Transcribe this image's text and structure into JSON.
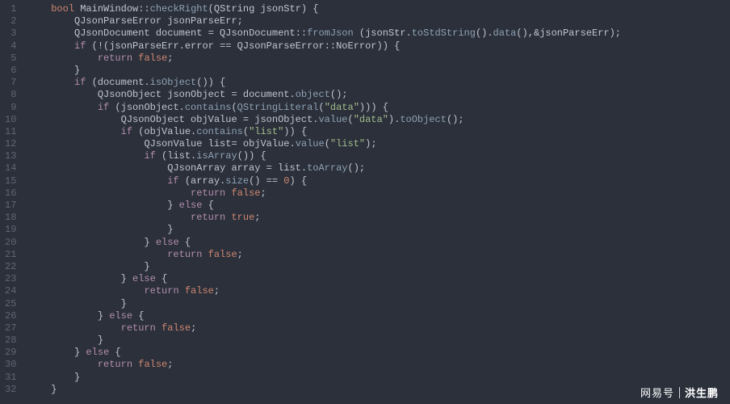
{
  "editor": {
    "language": "cpp",
    "line_count": 32,
    "colors": {
      "background": "#2b303b",
      "foreground": "#c0c5ce",
      "gutter": "#5f6773",
      "keyword": "#b48ead",
      "type": "#d08770",
      "class": "#ebcb8b",
      "function": "#8fa1b3",
      "string": "#a3be8c",
      "number": "#d08770",
      "boolean": "#d08770"
    },
    "lines": [
      {
        "n": 1,
        "indent": 1,
        "tokens": [
          [
            "type",
            "bool"
          ],
          [
            "ident",
            " MainWindow"
          ],
          [
            "op",
            "::"
          ],
          [
            "func",
            "checkRight"
          ],
          [
            "punct",
            "("
          ],
          [
            "ident",
            "QString jsonStr"
          ],
          [
            "punct",
            ") {"
          ]
        ]
      },
      {
        "n": 2,
        "indent": 2,
        "tokens": [
          [
            "ident",
            "QJsonParseError jsonParseErr;"
          ]
        ]
      },
      {
        "n": 3,
        "indent": 2,
        "tokens": [
          [
            "ident",
            "QJsonDocument document "
          ],
          [
            "op",
            "="
          ],
          [
            "ident",
            " QJsonDocument"
          ],
          [
            "op",
            "::"
          ],
          [
            "func",
            "fromJson"
          ],
          [
            "ident",
            " (jsonStr."
          ],
          [
            "func",
            "toStdString"
          ],
          [
            "punct",
            "()."
          ],
          [
            "func",
            "data"
          ],
          [
            "punct",
            "(),"
          ],
          [
            "op",
            "&"
          ],
          [
            "ident",
            "jsonParseErr);"
          ]
        ]
      },
      {
        "n": 4,
        "indent": 2,
        "tokens": [
          [
            "kw",
            "if"
          ],
          [
            "ident",
            " ("
          ],
          [
            "op",
            "!"
          ],
          [
            "ident",
            "(jsonParseErr.error "
          ],
          [
            "op",
            "=="
          ],
          [
            "ident",
            " QJsonParseError"
          ],
          [
            "op",
            "::"
          ],
          [
            "ident",
            "NoError)) {"
          ]
        ]
      },
      {
        "n": 5,
        "indent": 3,
        "tokens": [
          [
            "kw",
            "return"
          ],
          [
            "ident",
            " "
          ],
          [
            "bool",
            "false"
          ],
          [
            "punct",
            ";"
          ]
        ]
      },
      {
        "n": 6,
        "indent": 2,
        "tokens": [
          [
            "punct",
            "}"
          ]
        ]
      },
      {
        "n": 7,
        "indent": 2,
        "tokens": [
          [
            "kw",
            "if"
          ],
          [
            "ident",
            " (document."
          ],
          [
            "func",
            "isObject"
          ],
          [
            "punct",
            "()) {"
          ]
        ]
      },
      {
        "n": 8,
        "indent": 3,
        "tokens": [
          [
            "ident",
            "QJsonObject jsonObject "
          ],
          [
            "op",
            "="
          ],
          [
            "ident",
            " document."
          ],
          [
            "func",
            "object"
          ],
          [
            "punct",
            "();"
          ]
        ]
      },
      {
        "n": 9,
        "indent": 3,
        "tokens": [
          [
            "kw",
            "if"
          ],
          [
            "ident",
            " (jsonObject."
          ],
          [
            "func",
            "contains"
          ],
          [
            "punct",
            "("
          ],
          [
            "func",
            "QStringLiteral"
          ],
          [
            "punct",
            "("
          ],
          [
            "str",
            "\"data\""
          ],
          [
            "punct",
            "))) {"
          ]
        ]
      },
      {
        "n": 10,
        "indent": 4,
        "tokens": [
          [
            "ident",
            "QJsonObject objValue "
          ],
          [
            "op",
            "="
          ],
          [
            "ident",
            " jsonObject."
          ],
          [
            "func",
            "value"
          ],
          [
            "punct",
            "("
          ],
          [
            "str",
            "\"data\""
          ],
          [
            "punct",
            ")."
          ],
          [
            "func",
            "toObject"
          ],
          [
            "punct",
            "();"
          ]
        ]
      },
      {
        "n": 11,
        "indent": 4,
        "tokens": [
          [
            "kw",
            "if"
          ],
          [
            "ident",
            " (objValue."
          ],
          [
            "func",
            "contains"
          ],
          [
            "punct",
            "("
          ],
          [
            "str",
            "\"list\""
          ],
          [
            "punct",
            ")) {"
          ]
        ]
      },
      {
        "n": 12,
        "indent": 5,
        "tokens": [
          [
            "ident",
            "QJsonValue list"
          ],
          [
            "op",
            "="
          ],
          [
            "ident",
            " objValue."
          ],
          [
            "func",
            "value"
          ],
          [
            "punct",
            "("
          ],
          [
            "str",
            "\"list\""
          ],
          [
            "punct",
            ");"
          ]
        ]
      },
      {
        "n": 13,
        "indent": 5,
        "tokens": [
          [
            "kw",
            "if"
          ],
          [
            "ident",
            " (list."
          ],
          [
            "func",
            "isArray"
          ],
          [
            "punct",
            "()) {"
          ]
        ]
      },
      {
        "n": 14,
        "indent": 6,
        "tokens": [
          [
            "ident",
            "QJsonArray array "
          ],
          [
            "op",
            "="
          ],
          [
            "ident",
            " list."
          ],
          [
            "func",
            "toArray"
          ],
          [
            "punct",
            "();"
          ]
        ]
      },
      {
        "n": 15,
        "indent": 6,
        "tokens": [
          [
            "kw",
            "if"
          ],
          [
            "ident",
            " (array."
          ],
          [
            "func",
            "size"
          ],
          [
            "punct",
            "() "
          ],
          [
            "op",
            "=="
          ],
          [
            "ident",
            " "
          ],
          [
            "num",
            "0"
          ],
          [
            "punct",
            ") {"
          ]
        ]
      },
      {
        "n": 16,
        "indent": 7,
        "tokens": [
          [
            "kw",
            "return"
          ],
          [
            "ident",
            " "
          ],
          [
            "bool",
            "false"
          ],
          [
            "punct",
            ";"
          ]
        ]
      },
      {
        "n": 17,
        "indent": 6,
        "tokens": [
          [
            "punct",
            "} "
          ],
          [
            "kw",
            "else"
          ],
          [
            "punct",
            " {"
          ]
        ]
      },
      {
        "n": 18,
        "indent": 7,
        "tokens": [
          [
            "kw",
            "return"
          ],
          [
            "ident",
            " "
          ],
          [
            "bool",
            "true"
          ],
          [
            "punct",
            ";"
          ]
        ]
      },
      {
        "n": 19,
        "indent": 6,
        "tokens": [
          [
            "punct",
            "}"
          ]
        ]
      },
      {
        "n": 20,
        "indent": 5,
        "tokens": [
          [
            "punct",
            "} "
          ],
          [
            "kw",
            "else"
          ],
          [
            "punct",
            " {"
          ]
        ]
      },
      {
        "n": 21,
        "indent": 6,
        "tokens": [
          [
            "kw",
            "return"
          ],
          [
            "ident",
            " "
          ],
          [
            "bool",
            "false"
          ],
          [
            "punct",
            ";"
          ]
        ]
      },
      {
        "n": 22,
        "indent": 5,
        "tokens": [
          [
            "punct",
            "}"
          ]
        ]
      },
      {
        "n": 23,
        "indent": 4,
        "tokens": [
          [
            "punct",
            "} "
          ],
          [
            "kw",
            "else"
          ],
          [
            "punct",
            " {"
          ]
        ]
      },
      {
        "n": 24,
        "indent": 5,
        "tokens": [
          [
            "kw",
            "return"
          ],
          [
            "ident",
            " "
          ],
          [
            "bool",
            "false"
          ],
          [
            "punct",
            ";"
          ]
        ]
      },
      {
        "n": 25,
        "indent": 4,
        "tokens": [
          [
            "punct",
            "}"
          ]
        ]
      },
      {
        "n": 26,
        "indent": 3,
        "tokens": [
          [
            "punct",
            "} "
          ],
          [
            "kw",
            "else"
          ],
          [
            "punct",
            " {"
          ]
        ]
      },
      {
        "n": 27,
        "indent": 4,
        "tokens": [
          [
            "kw",
            "return"
          ],
          [
            "ident",
            " "
          ],
          [
            "bool",
            "false"
          ],
          [
            "punct",
            ";"
          ]
        ]
      },
      {
        "n": 28,
        "indent": 3,
        "tokens": [
          [
            "punct",
            "}"
          ]
        ]
      },
      {
        "n": 29,
        "indent": 2,
        "tokens": [
          [
            "punct",
            "} "
          ],
          [
            "kw",
            "else"
          ],
          [
            "punct",
            " {"
          ]
        ]
      },
      {
        "n": 30,
        "indent": 3,
        "tokens": [
          [
            "kw",
            "return"
          ],
          [
            "ident",
            " "
          ],
          [
            "bool",
            "false"
          ],
          [
            "punct",
            ";"
          ]
        ]
      },
      {
        "n": 31,
        "indent": 2,
        "tokens": [
          [
            "punct",
            "}"
          ]
        ]
      },
      {
        "n": 32,
        "indent": 1,
        "tokens": [
          [
            "punct",
            "}"
          ]
        ]
      }
    ]
  },
  "watermark": {
    "brand": "网易号",
    "author": "洪生鹏"
  }
}
